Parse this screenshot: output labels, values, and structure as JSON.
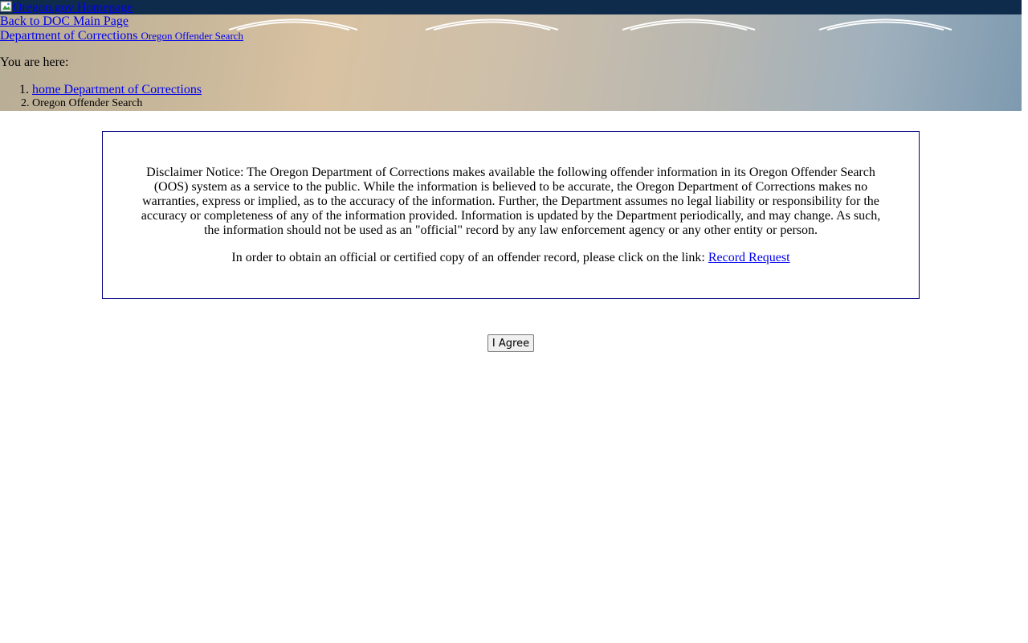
{
  "header": {
    "homepage_link": "Oregon.gov Homepage",
    "back_link": "Back to DOC Main Page",
    "site_title": "Department of Corrections",
    "site_subtitle": "Oregon Offender Search",
    "you_are_here": "You are here:",
    "breadcrumb": [
      {
        "label": "home Department of Corrections"
      },
      {
        "label": "Oregon Offender Search"
      }
    ]
  },
  "notice": {
    "disclaimer": "Disclaimer Notice: The Oregon Department of Corrections makes available the following offender information in its Oregon Offender Search (OOS) system as a service to the public. While the information is believed to be accurate, the Oregon Department of Corrections makes no warranties, express or implied, as to the accuracy of the information. Further, the Department assumes no legal liability or responsibility for the accuracy or completeness of any of the information provided. Information is updated by the Department periodically, and may change. As such, the information should not be used as an \"official\" record by any law enforcement agency or any other entity or person.",
    "request_text": "In order to obtain an official or certified copy of an offender record, please click on the link:",
    "request_link": "Record Request"
  },
  "agree_button": "I Agree",
  "colors": {
    "topbar": "#0f2b4c",
    "link": "#0000ee",
    "notice_border": "#000080"
  }
}
